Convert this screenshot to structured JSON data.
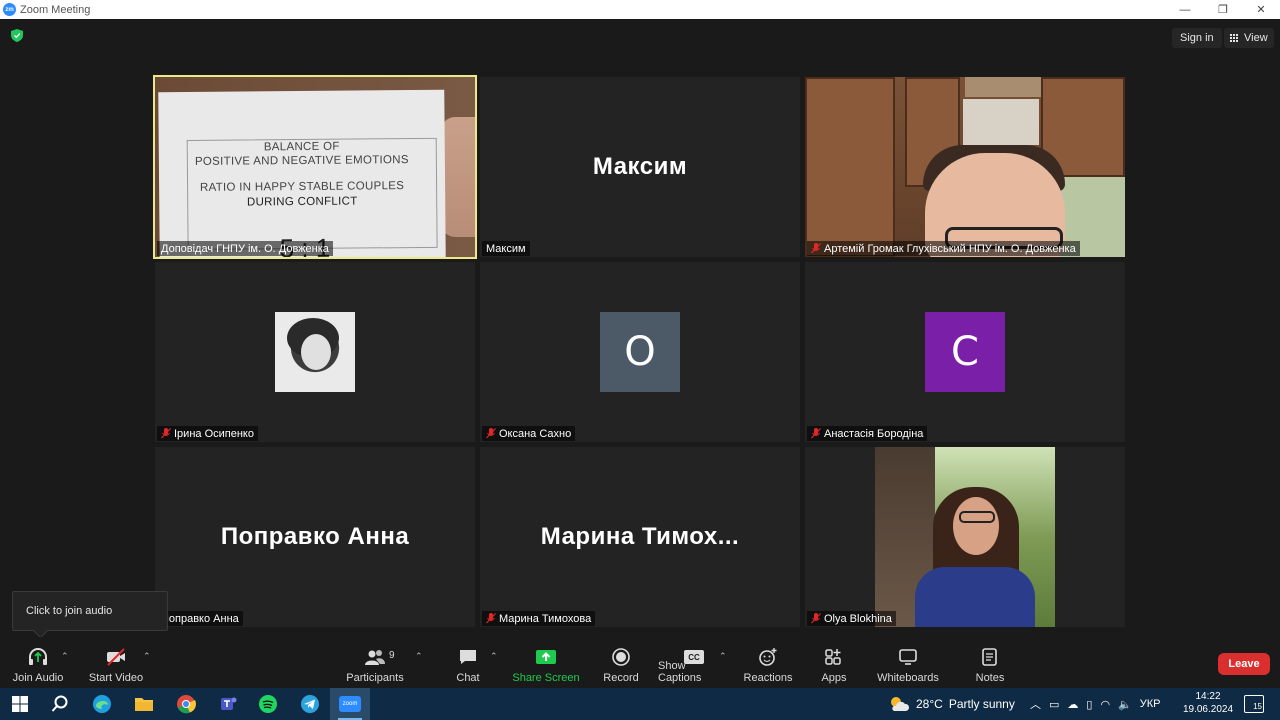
{
  "window": {
    "title": "Zoom Meeting",
    "controls": {
      "minimize": "—",
      "maximize": "❐",
      "close": "✕"
    }
  },
  "topbar": {
    "signin_label": "Sign in",
    "view_label": "View"
  },
  "tiles": [
    {
      "name": "Доповідач ГНПУ ім. О. Довженка",
      "muted": false,
      "active": true,
      "paper": {
        "line1": "BALANCE OF",
        "line2": "POSITIVE AND NEGATIVE EMOTIONS",
        "line3": "RATIO IN HAPPY STABLE COUPLES",
        "line4": "DURING CONFLICT",
        "ratio": "5 : 1"
      }
    },
    {
      "name": "Максим",
      "display_name": "Максим",
      "muted": false
    },
    {
      "name": "Артемій Громак Глухівський НПУ ім. О. Довженка",
      "muted": true
    },
    {
      "name": "Ірина Осипенко",
      "muted": true
    },
    {
      "name": "Оксана Сахно",
      "muted": true,
      "initial": "O",
      "color": "#4b5a66"
    },
    {
      "name": "Анастасія Бородіна",
      "muted": true,
      "initial": "C",
      "color": "#7a1fa8"
    },
    {
      "name": "Поправко Анна",
      "display_name": "Поправко Анна",
      "muted": false
    },
    {
      "name": "Марина Тимохова",
      "display_name": "Марина  Тимох...",
      "muted": true
    },
    {
      "name": "Olya Blokhina",
      "muted": true
    }
  ],
  "tooltip": {
    "text": "Click to join audio"
  },
  "toolbar": {
    "join_audio": "Join Audio",
    "start_video": "Start Video",
    "participants": "Participants",
    "participants_count": "9",
    "chat": "Chat",
    "share_screen": "Share Screen",
    "record": "Record",
    "show_captions": "Show Captions",
    "reactions": "Reactions",
    "apps": "Apps",
    "whiteboards": "Whiteboards",
    "notes": "Notes",
    "leave": "Leave",
    "captions_badge": "CC"
  },
  "taskbar": {
    "weather_temp": "28°C",
    "weather_text": "Partly sunny",
    "language": "УКР",
    "time": "14:22",
    "date": "19.06.2024",
    "notifications": "15",
    "zoom_label": "zoom"
  },
  "colors": {
    "active_speaker": "#ebe98a",
    "share_green": "#1ecb4f",
    "leave_red": "#d92f2f",
    "taskbar": "#0f2a44"
  }
}
